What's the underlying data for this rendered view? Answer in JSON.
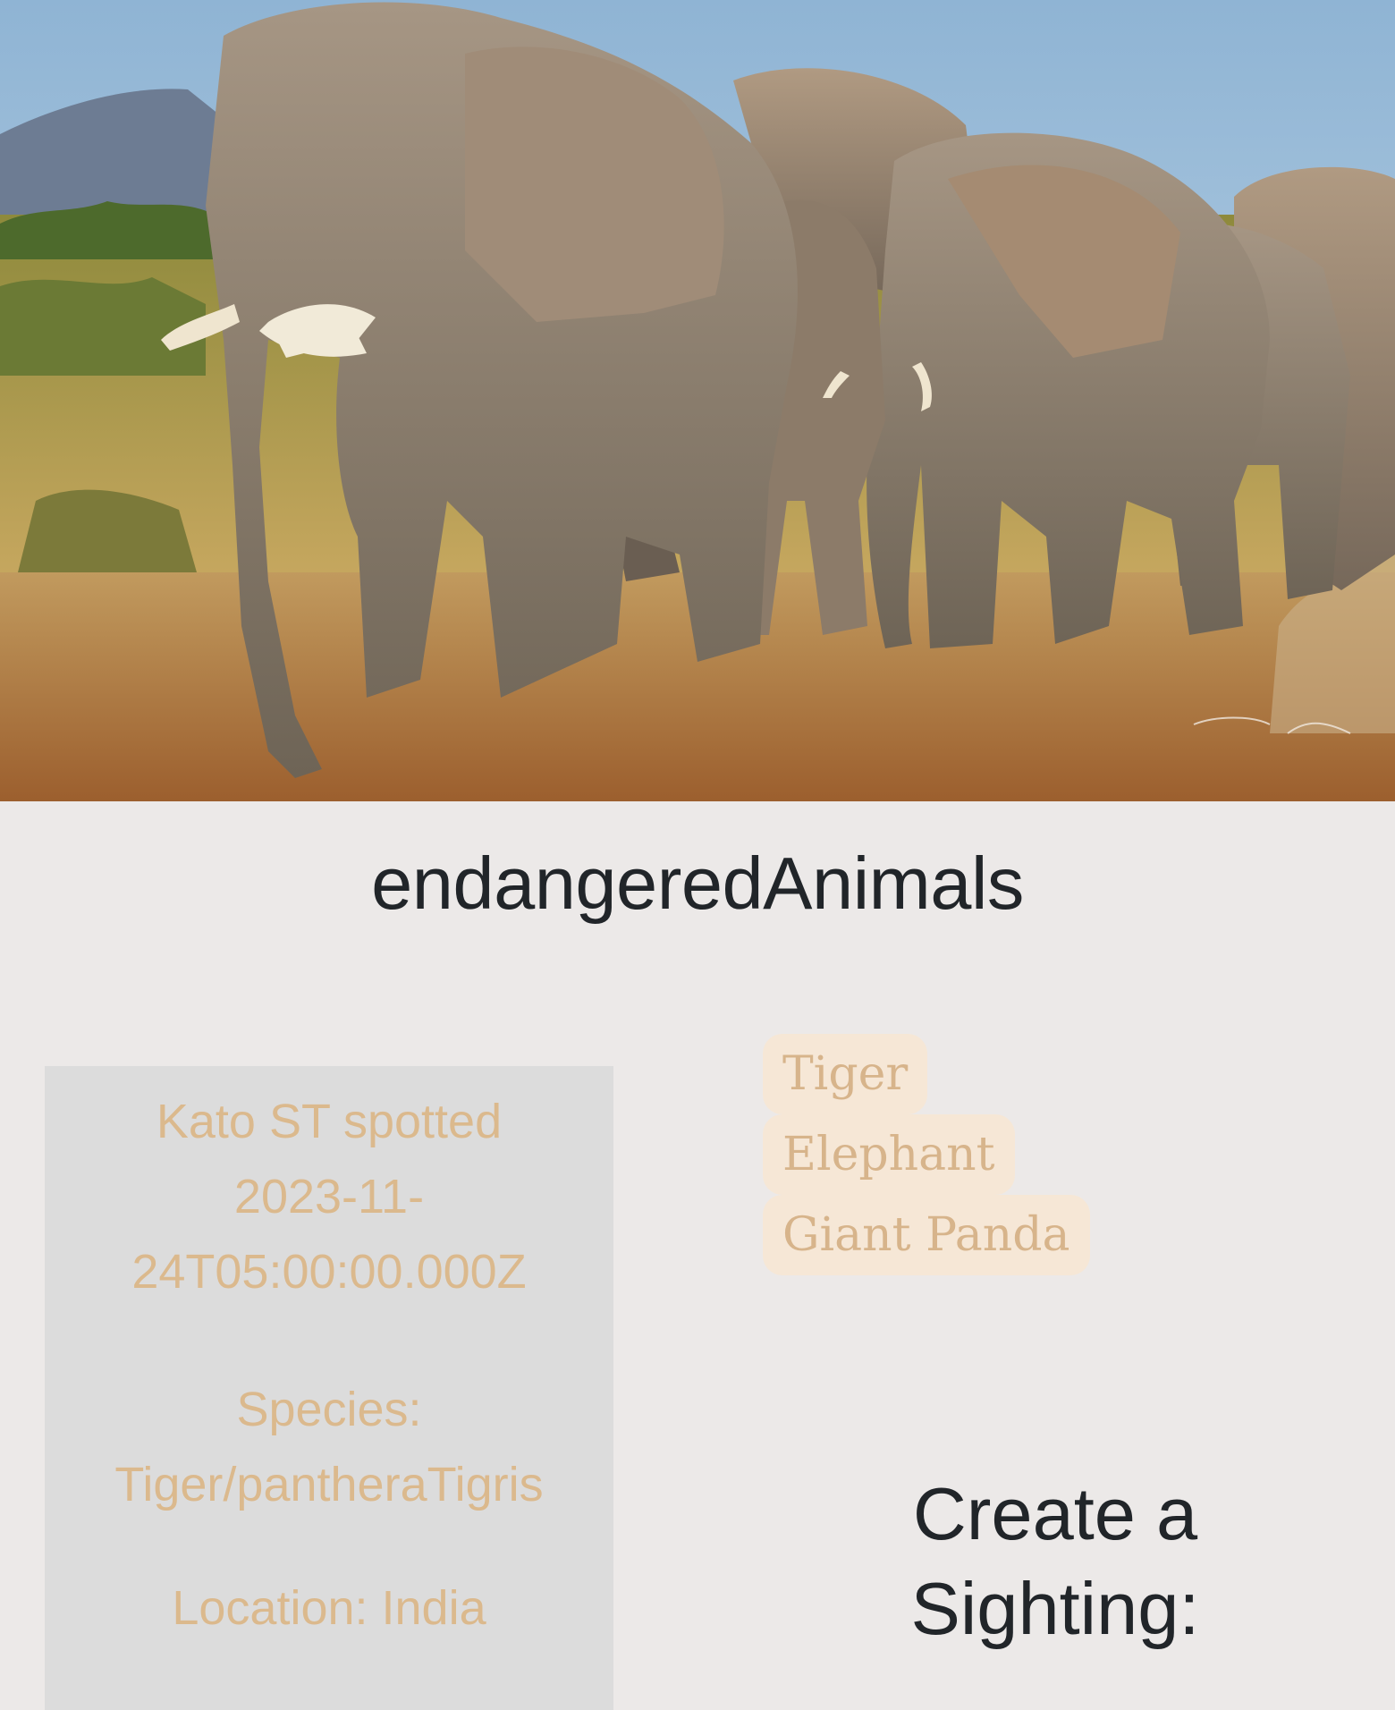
{
  "app": {
    "title": "endangeredAnimals"
  },
  "hero": {
    "image": "herd of elephants walking",
    "watermark": "signature"
  },
  "sighting_card": {
    "spotted_line": "Kato ST spotted 2023-11-24T05:00:00.000Z",
    "species_line": "Species: Tiger/pantheraTigris",
    "location_line": "Location: India"
  },
  "species_list": {
    "items": [
      {
        "label": "Tiger"
      },
      {
        "label": "Elephant"
      },
      {
        "label": "Giant Panda"
      }
    ]
  },
  "create_sighting": {
    "heading": "Create a Sighting:"
  },
  "colors": {
    "background": "#ece9e8",
    "card_background": "#dcdcdc",
    "accent_text": "#dbb98d",
    "tag_background": "#f6e7d6",
    "heading_text": "#212529"
  }
}
